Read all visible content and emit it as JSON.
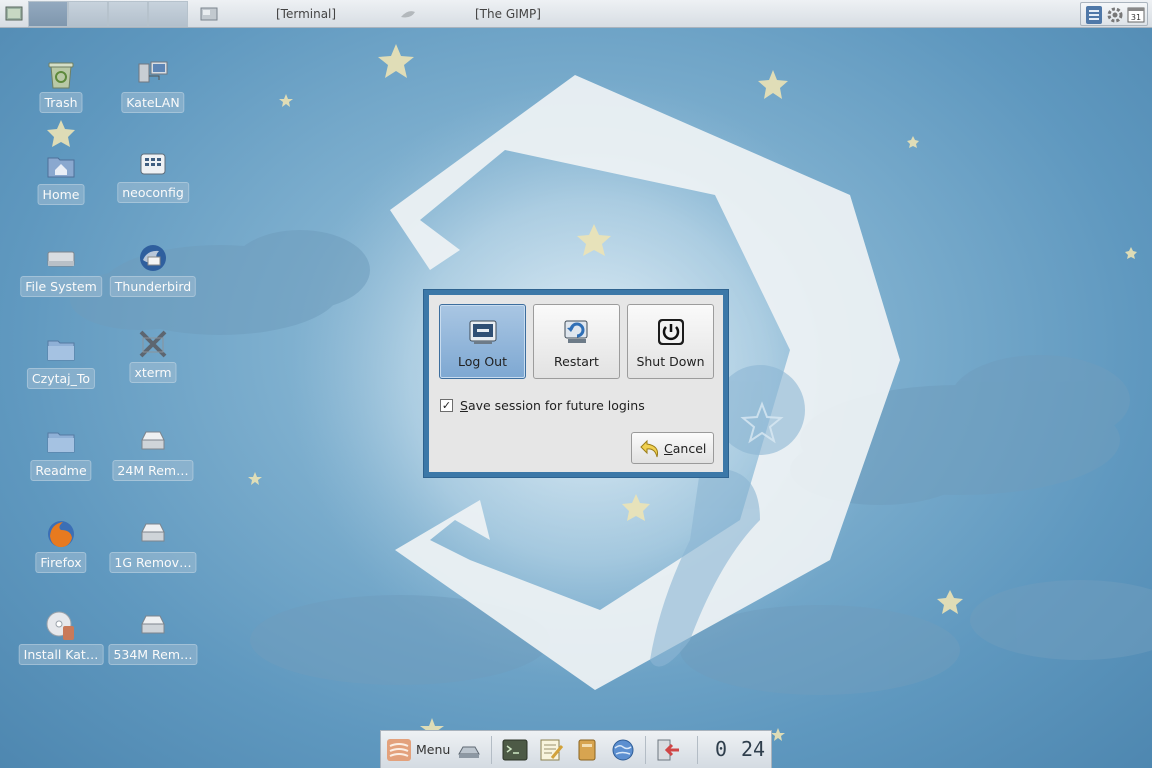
{
  "top_panel": {
    "tasks": [
      {
        "label": "[Terminal]"
      },
      {
        "label": "[The GIMP]"
      }
    ]
  },
  "desktop": {
    "icons": [
      {
        "label": "Trash",
        "icon": "trash-icon"
      },
      {
        "label": "KateLAN",
        "icon": "network-icon"
      },
      {
        "label": "Home",
        "icon": "home-folder-icon"
      },
      {
        "label": "neoconfig",
        "icon": "config-icon"
      },
      {
        "label": "File System",
        "icon": "hard-drive-icon"
      },
      {
        "label": "Thunderbird",
        "icon": "thunderbird-icon"
      },
      {
        "label": "Czytaj_To",
        "icon": "folder-icon"
      },
      {
        "label": "xterm",
        "icon": "xterm-icon"
      },
      {
        "label": "Readme",
        "icon": "folder-icon"
      },
      {
        "label": "24M Rem…",
        "icon": "removable-drive-icon"
      },
      {
        "label": "Firefox",
        "icon": "firefox-icon"
      },
      {
        "label": "1G Remov…",
        "icon": "removable-drive-icon"
      },
      {
        "label": "Install Kat…",
        "icon": "install-cd-icon"
      },
      {
        "label": "534M Rem…",
        "icon": "removable-drive-icon"
      }
    ]
  },
  "logout_dialog": {
    "options": [
      {
        "label": "Log Out",
        "icon": "logout-icon",
        "selected": true
      },
      {
        "label": "Restart",
        "icon": "restart-icon",
        "selected": false
      },
      {
        "label": "Shut Down",
        "icon": "power-icon",
        "selected": false
      }
    ],
    "save_session": {
      "mnemonic": "S",
      "label_rest": "ave session for future logins",
      "checked": true,
      "check_mark": "✓"
    },
    "cancel": {
      "mnemonic": "C",
      "label_rest": "ancel",
      "icon": "undo-arrow-icon"
    }
  },
  "bottom_panel": {
    "menu_label": "Menu",
    "pager_numbers": [
      "0",
      "24"
    ]
  },
  "colors": {
    "dialog_border": "#3c78a8",
    "selected_option": "#7ea8d2",
    "wallpaper": "#6aa1c6"
  }
}
